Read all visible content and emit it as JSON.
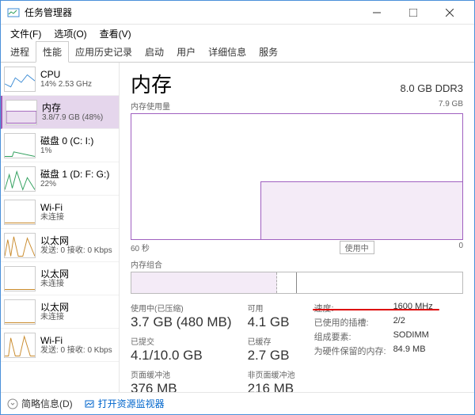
{
  "window": {
    "title": "任务管理器"
  },
  "menu": {
    "file": "文件(F)",
    "options": "选项(O)",
    "view": "查看(V)"
  },
  "tabs": {
    "processes": "进程",
    "performance": "性能",
    "app_history": "应用历史记录",
    "startup": "启动",
    "users": "用户",
    "details": "详细信息",
    "services": "服务"
  },
  "sidebar": {
    "items": [
      {
        "name": "CPU",
        "sub": "14% 2.53 GHz",
        "color": "#3b8bd4"
      },
      {
        "name": "内存",
        "sub": "3.8/7.9 GB (48%)",
        "color": "#9b59b6",
        "selected": true
      },
      {
        "name": "磁盘 0 (C: I:)",
        "sub": "1%",
        "color": "#2e9e5b"
      },
      {
        "name": "磁盘 1 (D: F: G:)",
        "sub": "22%",
        "color": "#2e9e5b"
      },
      {
        "name": "Wi-Fi",
        "sub": "未连接",
        "color": "#c98a2b"
      },
      {
        "name": "以太网",
        "sub": "发送: 0 接收: 0 Kbps",
        "color": "#c98a2b"
      },
      {
        "name": "以太网",
        "sub": "未连接",
        "color": "#c98a2b"
      },
      {
        "name": "以太网",
        "sub": "未连接",
        "color": "#c98a2b"
      },
      {
        "name": "Wi-Fi",
        "sub": "发送: 0 接收: 0 Kbps",
        "color": "#c98a2b"
      }
    ]
  },
  "main": {
    "title": "内存",
    "subtitle_right": "8.0 GB DDR3",
    "chart_top_left": "内存使用量",
    "chart_top_right": "7.9 GB",
    "chart_bottom_left": "60 秒",
    "chart_bottom_right": "0",
    "use_ind_label": "使用中",
    "composition_label": "内存组合",
    "stats": {
      "in_use_label": "使用中(已压缩)",
      "in_use_value": "3.7 GB (480 MB)",
      "available_label": "可用",
      "available_value": "4.1 GB",
      "committed_label": "已提交",
      "committed_value": "4.1/10.0 GB",
      "cached_label": "已缓存",
      "cached_value": "2.7 GB",
      "paged_label": "页面缓冲池",
      "paged_value": "376 MB",
      "nonpaged_label": "非页面缓冲池",
      "nonpaged_value": "216 MB"
    },
    "kv": {
      "speed_label": "速度:",
      "speed_value": "1600 MHz",
      "slots_label": "已使用的插槽:",
      "slots_value": "2/2",
      "form_label": "组成要素:",
      "form_value": "SODIMM",
      "hw_reserved_label": "为硬件保留的内存:",
      "hw_reserved_value": "84.9 MB"
    }
  },
  "footer": {
    "brief": "简略信息(D)",
    "monitor_link": "打开资源监视器"
  },
  "chart_data": {
    "type": "area",
    "title": "内存使用量",
    "xlabel": "60 秒 → 0",
    "ylabel": "GB",
    "ylim": [
      0,
      7.9
    ],
    "x_seconds": [
      60,
      55,
      50,
      45,
      40,
      35,
      30,
      25,
      20,
      15,
      10,
      5,
      0
    ],
    "values_gb": [
      0,
      0,
      0,
      0,
      0,
      3.7,
      3.7,
      3.7,
      3.7,
      3.7,
      3.7,
      3.7,
      3.7
    ]
  }
}
